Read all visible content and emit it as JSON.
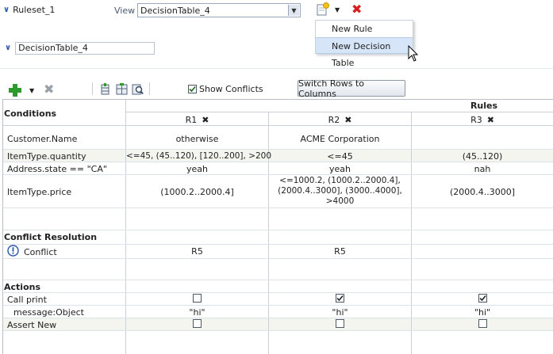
{
  "header": {
    "ruleset_label": "Ruleset_1",
    "view_label": "View",
    "view_value": "DecisionTable_4"
  },
  "menu": {
    "items": [
      "New Rule",
      "New Decision Table"
    ]
  },
  "decision_table": {
    "name": "DecisionTable_4"
  },
  "toolbar": {
    "show_conflicts_label": "Show Conflicts",
    "show_conflicts_checked": true,
    "switch_label": "Switch Rows to Columns"
  },
  "table": {
    "conditions_header": "Conditions",
    "rules_header": "Rules",
    "rules": [
      "R1",
      "R2",
      "R3"
    ],
    "condition_rows": [
      {
        "label": "Customer.Name",
        "values": [
          "otherwise",
          "ACME Corporation",
          ""
        ]
      },
      {
        "label": "ItemType.quantity",
        "values": [
          "<=45, (45..120), [120..200], >200",
          "<=45",
          "(45..120)"
        ]
      },
      {
        "label": "Address.state == \"CA\"",
        "values": [
          "yeah",
          "yeah",
          "nah"
        ]
      },
      {
        "label": "ItemType.price",
        "values": [
          "(1000.2..2000.4]",
          "",
          "(2000.4..3000]"
        ],
        "multiline_r2": [
          "<=1000.2, (1000.2..2000.4],",
          "(2000.4..3000], (3000..4000],",
          ">4000"
        ]
      }
    ],
    "conflict_section": "Conflict Resolution",
    "conflict_label": "Conflict",
    "conflict_values": [
      "R5",
      "R5",
      ""
    ],
    "actions_section": "Actions",
    "action_rows": [
      {
        "label": "Call print",
        "checks": [
          false,
          true,
          true
        ]
      },
      {
        "label": "message:Object",
        "values": [
          "\"hi\"",
          "\"hi\"",
          "\"hi\""
        ]
      },
      {
        "label": "Assert New",
        "checks": [
          false,
          false,
          false
        ]
      }
    ]
  },
  "colors": {
    "accent": "#2a58a8",
    "delete": "#d42020",
    "menu_highlight": "#d6e6f8",
    "add_green": "#2e9a2e"
  },
  "icons": [
    "chevron-down-icon",
    "new-rule-icon",
    "delete-icon",
    "add-icon",
    "cursor-icon",
    "conflict-info-icon"
  ]
}
